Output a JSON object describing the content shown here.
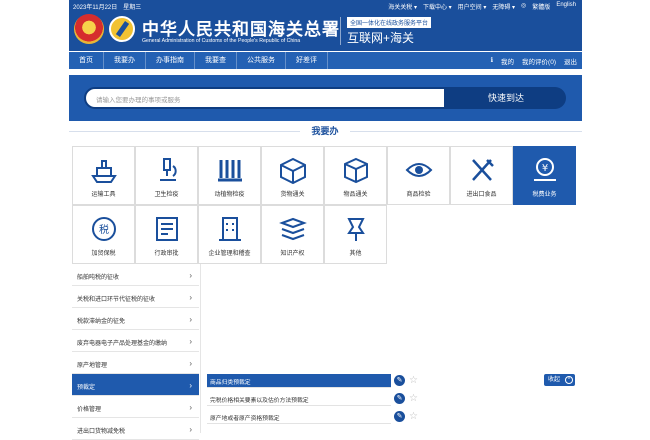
{
  "header": {
    "date": "2023年11月22日　星期三",
    "top_links": [
      "海关关税 ▾",
      "下载中心 ▾",
      "用户空间 ▾",
      "无障碍 ▾",
      "◎",
      "繁體版",
      "English"
    ],
    "title_cn": "中华人民共和国海关总署",
    "title_en": "General Administration of Customs of the People's Republic of China",
    "platform_sub": "全国一体化在线政务服务平台",
    "platform_main": "互联网+海关"
  },
  "nav": {
    "items": [
      "首页",
      "我要办",
      "办事指南",
      "我要查",
      "公共服务",
      "好差评"
    ],
    "right": [
      "ℹ",
      "我的",
      "我的评价(0)",
      "退出"
    ]
  },
  "search": {
    "placeholder": "请输入您要办理的事项或服务",
    "button": "快速到达"
  },
  "section_title": "我要办",
  "tiles": [
    {
      "label": "运输工具",
      "icon": "ship-icon"
    },
    {
      "label": "卫生检疫",
      "icon": "microscope-icon"
    },
    {
      "label": "动植物检疫",
      "icon": "test-tubes-icon"
    },
    {
      "label": "货物通关",
      "icon": "box-icon"
    },
    {
      "label": "物品通关",
      "icon": "package-icon"
    },
    {
      "label": "商品检验",
      "icon": "eye-icon"
    },
    {
      "label": "进出口食品",
      "icon": "utensils-icon"
    },
    {
      "label": "税费业务",
      "icon": "money-hand-icon"
    },
    {
      "label": "加贸保税",
      "icon": "tax-icon"
    },
    {
      "label": "行政审批",
      "icon": "approval-icon"
    },
    {
      "label": "企业管理和稽查",
      "icon": "building-icon"
    },
    {
      "label": "知识产权",
      "icon": "books-icon"
    },
    {
      "label": "其他",
      "icon": "pin-icon"
    }
  ],
  "side_list": [
    {
      "label": "船舶吨税的征收"
    },
    {
      "label": "关税和进口环节代征税的征收"
    },
    {
      "label": "税款滞纳金的征免"
    },
    {
      "label": "废弃电器电子产品处理基金的缴纳"
    },
    {
      "label": "原产地管理"
    },
    {
      "label": "预裁定"
    },
    {
      "label": "价格管理"
    },
    {
      "label": "进出口货物减免税"
    }
  ],
  "content_rows": [
    {
      "label": "商品归类预裁定"
    },
    {
      "label": "完税价格相关要素以及估价方法预裁定"
    },
    {
      "label": "原产地或者原产资格预裁定"
    }
  ],
  "collapse_label": "收起",
  "colors": {
    "primary": "#1a4f9c",
    "nav": "#2461b4",
    "active": "#1f5aad"
  }
}
